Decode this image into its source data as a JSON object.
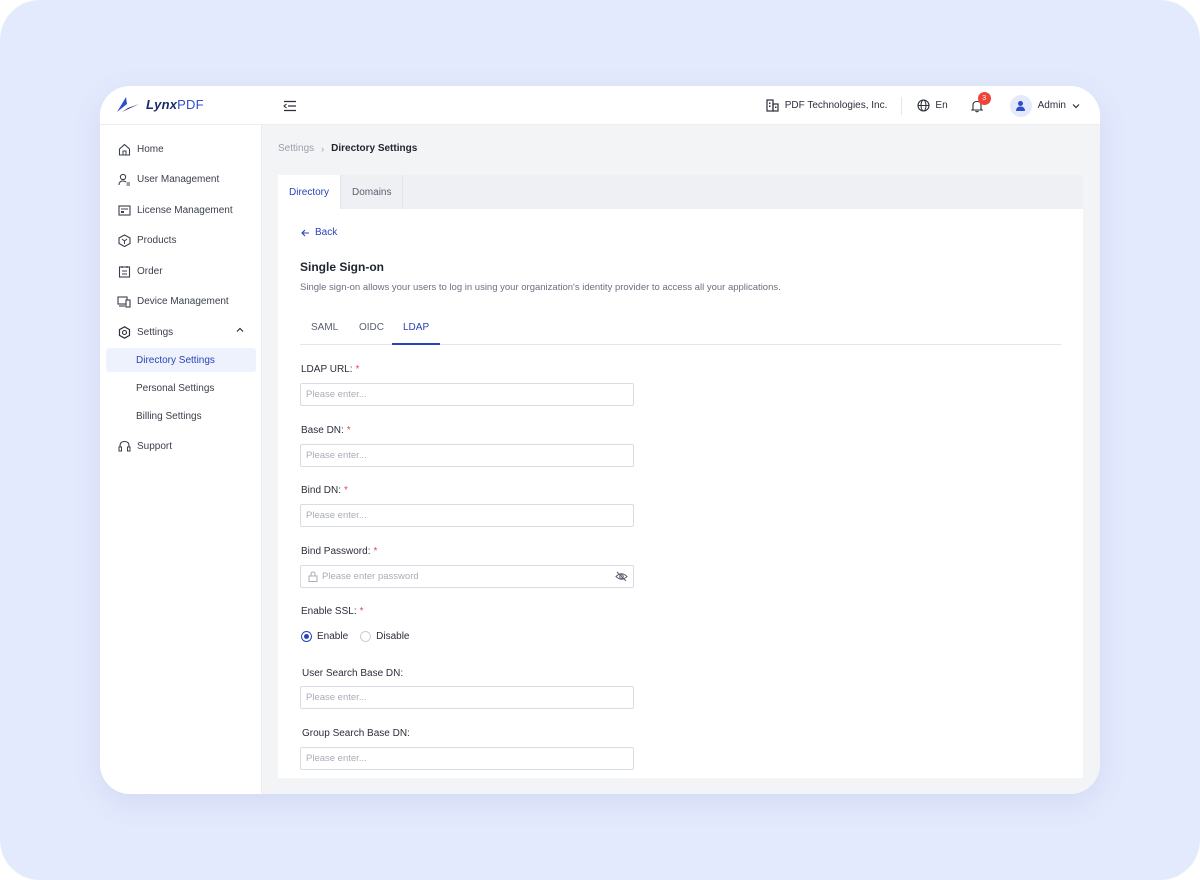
{
  "brand": {
    "name_part1": "Lynx",
    "name_part2": "PDF"
  },
  "topbar": {
    "organization": "PDF Technologies, Inc.",
    "language": "En",
    "notification_count": "3",
    "user": "Admin"
  },
  "sidebar": {
    "items": [
      {
        "label": "Home",
        "icon": "home-icon"
      },
      {
        "label": "User Management",
        "icon": "user-management-icon"
      },
      {
        "label": "License Management",
        "icon": "license-icon"
      },
      {
        "label": "Products",
        "icon": "products-icon"
      },
      {
        "label": "Order",
        "icon": "order-icon"
      },
      {
        "label": "Device Management",
        "icon": "device-icon"
      },
      {
        "label": "Settings",
        "icon": "gear-icon",
        "expanded": true
      },
      {
        "label": "Support",
        "icon": "headset-icon"
      }
    ],
    "settings_sub": [
      {
        "label": "Directory Settings",
        "active": true
      },
      {
        "label": "Personal Settings"
      },
      {
        "label": "Billing Settings"
      }
    ]
  },
  "breadcrumb": {
    "parent": "Settings",
    "current": "Directory Settings"
  },
  "tabs": [
    {
      "label": "Directory",
      "active": true
    },
    {
      "label": "Domains"
    }
  ],
  "back_label": "Back",
  "sso": {
    "title": "Single Sign-on",
    "description": "Single sign-on allows your users to log in using your organization's identity provider to access all your applications."
  },
  "protocol_tabs": [
    {
      "label": "SAML"
    },
    {
      "label": "OIDC"
    },
    {
      "label": "LDAP",
      "active": true
    }
  ],
  "form": {
    "ldap_url": {
      "label": "LDAP URL:",
      "placeholder": "Please enter...",
      "required": "*"
    },
    "base_dn": {
      "label": "Base DN:",
      "placeholder": "Please enter...",
      "required": "*"
    },
    "bind_dn": {
      "label": "Bind DN:",
      "placeholder": "Please enter...",
      "required": "*"
    },
    "bind_password": {
      "label": "Bind Password:",
      "placeholder": "Please enter password",
      "required": "*"
    },
    "enable_ssl": {
      "label": "Enable SSL:",
      "required": "*",
      "options": [
        "Enable",
        "Disable"
      ],
      "selected": "Enable"
    },
    "user_search_base_dn": {
      "label": "User Search Base DN:",
      "placeholder": "Please enter..."
    },
    "group_search_base_dn": {
      "label": "Group Search Base DN:",
      "placeholder": "Please enter..."
    }
  },
  "colors": {
    "accent": "#2844b8",
    "page_bg": "#e4eafd",
    "required": "#e5484d",
    "badge": "#f04438"
  }
}
